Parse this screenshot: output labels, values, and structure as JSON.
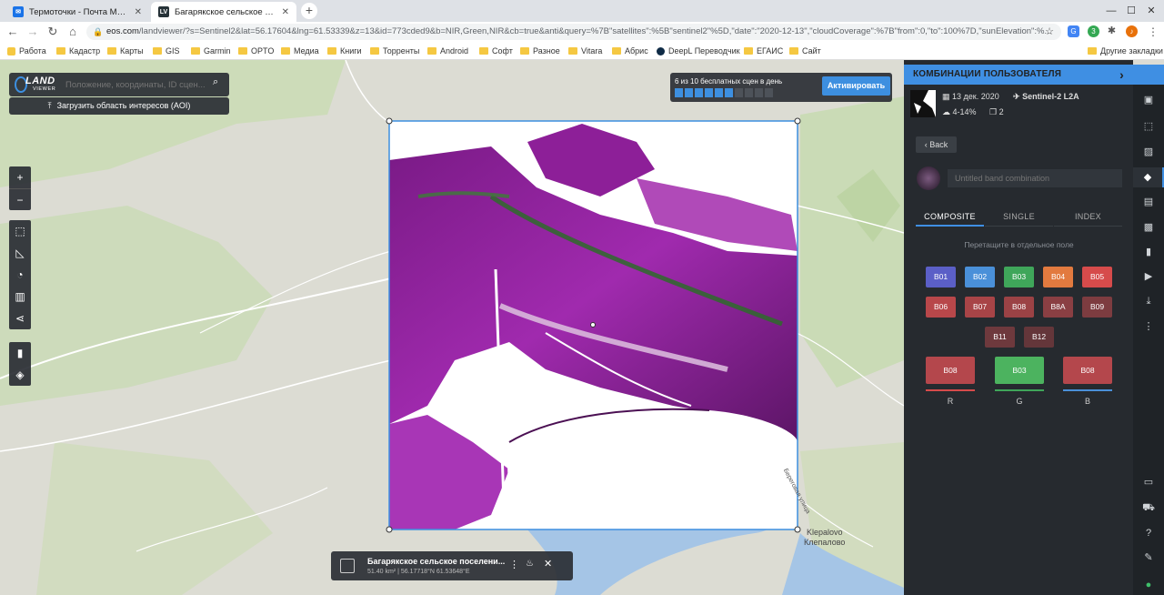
{
  "browser": {
    "tabs": [
      {
        "title": "Термоточки - Почта Mail.ru",
        "active": false,
        "fav_color": "#1a73e8",
        "fav_text": "✉"
      },
      {
        "title": "Багарякское сельское поселение",
        "active": true,
        "fav_color": "#263238",
        "fav_text": "LV"
      }
    ],
    "url_host": "eos.com",
    "url_rest": "/landviewer/?s=Sentinel2&lat=56.17604&lng=61.53339&z=13&id=773cded9&b=NIR,Green,NIR&cb=true&anti&query=%7B\"satellites\":%5B\"sentinel2\"%5D,\"date\":\"2020-12-13\",\"cloudCoverage\":%7B\"from\":0,\"to\":100%7D,\"sunElevation\":%...",
    "ext_badge": "3"
  },
  "bookmarks": [
    {
      "label": "Работа",
      "type": "app"
    },
    {
      "label": "Кадастр",
      "type": "folder"
    },
    {
      "label": "Карты",
      "type": "folder"
    },
    {
      "label": "GIS",
      "type": "folder"
    },
    {
      "label": "Garmin",
      "type": "folder"
    },
    {
      "label": "OPTO",
      "type": "folder"
    },
    {
      "label": "Медиа",
      "type": "folder"
    },
    {
      "label": "Книги",
      "type": "folder"
    },
    {
      "label": "Торренты",
      "type": "folder"
    },
    {
      "label": "Android",
      "type": "folder"
    },
    {
      "label": "Софт",
      "type": "folder"
    },
    {
      "label": "Разное",
      "type": "folder"
    },
    {
      "label": "Vitara",
      "type": "folder"
    },
    {
      "label": "Абрис",
      "type": "folder"
    },
    {
      "label": "DeepL Переводчик",
      "type": "deepl"
    },
    {
      "label": "ЕГАИС",
      "type": "folder"
    },
    {
      "label": "Сайт",
      "type": "folder"
    }
  ],
  "other_bookmarks": "Другие закладки",
  "app": {
    "logo_line1": "LAND",
    "logo_line2": "VIEWER",
    "search_placeholder": "Положение, координаты, ID сцен...",
    "aoi_button": "Загрузить область интересов (AOI)",
    "quota_text": "6 из 10 бесплатных сцен в день",
    "quota_used": 6,
    "quota_total": 10,
    "activate_button": "Активировать",
    "place_label_1": "Klepalovo",
    "place_label_2": "Клепалово",
    "street_label": "Береговая улица",
    "aoi_name": "Багарякское сельское поселени...",
    "aoi_info": "51.40 km² | 56.17718°N 61.53648°E"
  },
  "panel": {
    "title": "КОМБИНАЦИИ ПОЛЬЗОВАТЕЛЯ",
    "scene_date": "13 дек. 2020",
    "satellite": "Sentinel-2 L2A",
    "cloud": "4-14%",
    "count": "2",
    "back_button": "Back",
    "combo_name_placeholder": "Untitled band combination",
    "tabs": [
      "COMPOSITE",
      "SINGLE",
      "INDEX"
    ],
    "active_tab": "COMPOSITE",
    "drag_hint": "Перетащите в отдельное поле",
    "bands": [
      {
        "label": "B01",
        "color": "#5b5fc7"
      },
      {
        "label": "B02",
        "color": "#4a90d9"
      },
      {
        "label": "B03",
        "color": "#3fa65a"
      },
      {
        "label": "B04",
        "color": "#e27a3f"
      },
      {
        "label": "B05",
        "color": "#d64b4b"
      },
      {
        "label": "B06",
        "color": "#b8474a"
      },
      {
        "label": "B07",
        "color": "#a84447"
      },
      {
        "label": "B08",
        "color": "#9b4245"
      },
      {
        "label": "B8A",
        "color": "#8a3f43"
      },
      {
        "label": "B09",
        "color": "#7d3c40"
      },
      {
        "label": "B11",
        "color": "#6e393d"
      },
      {
        "label": "B12",
        "color": "#64363a"
      }
    ],
    "slots": [
      {
        "band": "B08",
        "channel": "R",
        "color": "#b4474c",
        "line": "#d64b4b"
      },
      {
        "band": "B03",
        "channel": "G",
        "color": "#4cb35f",
        "line": "#3fa65a"
      },
      {
        "band": "B08",
        "channel": "B",
        "color": "#b4474c",
        "line": "#4a90d9"
      }
    ]
  }
}
